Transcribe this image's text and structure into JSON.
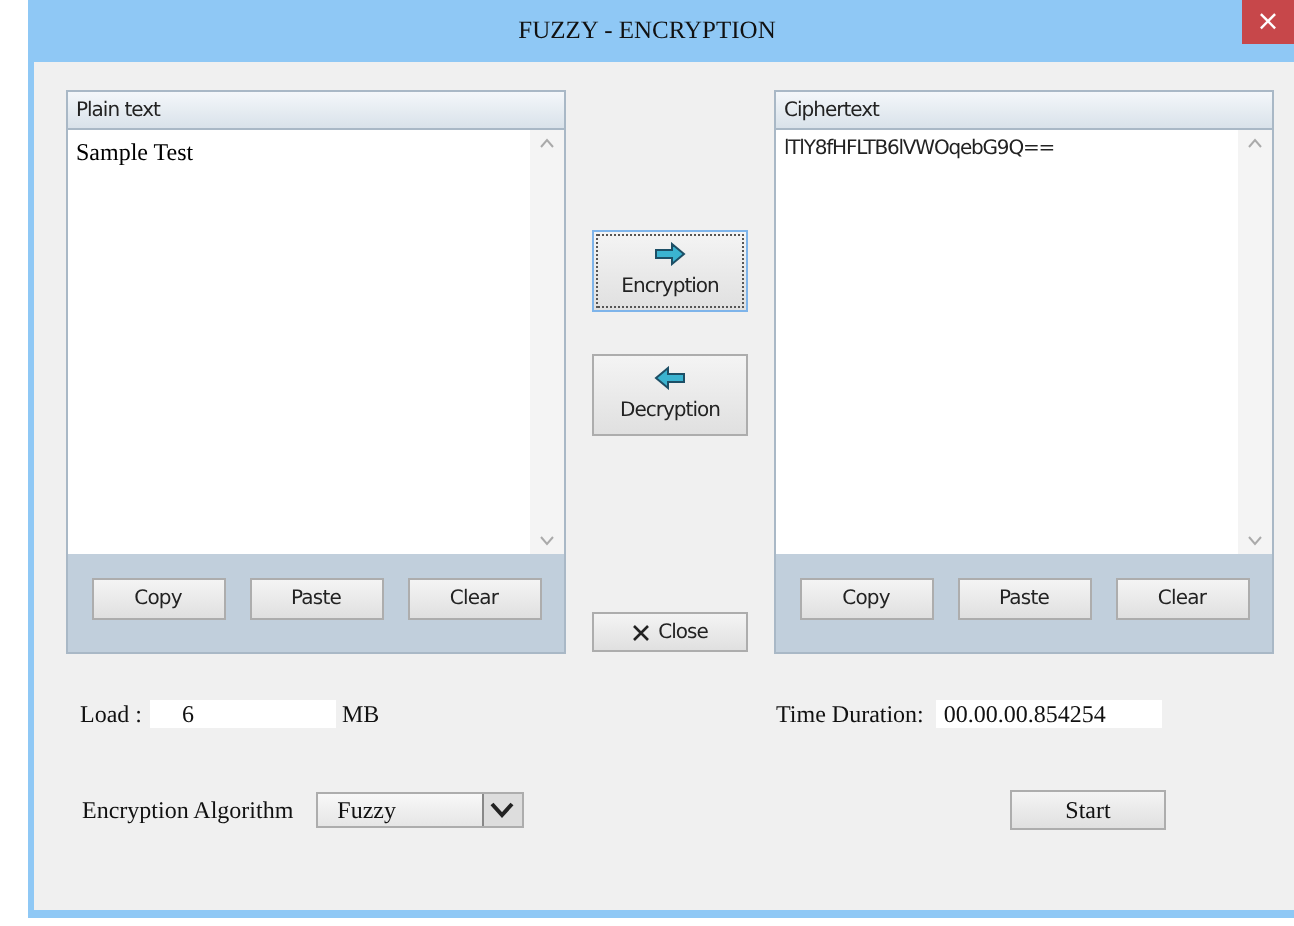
{
  "window": {
    "title": "FUZZY - ENCRYPTION",
    "close": "×"
  },
  "panels": [
    {
      "header": "Plain text",
      "text": "Sample Test",
      "kind": "plain",
      "buttons": [
        "Copy",
        "Paste",
        "Clear"
      ]
    },
    {
      "header": "Ciphertext",
      "text": "lTlY8fHFLTB6lVWOqebG9Q==",
      "kind": "cipher",
      "buttons": [
        "Copy",
        "Paste",
        "Clear"
      ]
    }
  ],
  "actions": [
    {
      "label": "Encryption",
      "kind": "encrypt",
      "focused": true
    },
    {
      "label": "Decryption",
      "kind": "decrypt",
      "focused": false
    }
  ],
  "close_button": {
    "label": "Close"
  },
  "load": {
    "label": "Load :",
    "value": "6",
    "unit": "MB"
  },
  "time": {
    "label": "Time Duration:",
    "value": "00.00.00.854254"
  },
  "algorithm": {
    "label": "Encryption Algorithm",
    "value": "Fuzzy"
  },
  "start_button": {
    "label": "Start"
  }
}
